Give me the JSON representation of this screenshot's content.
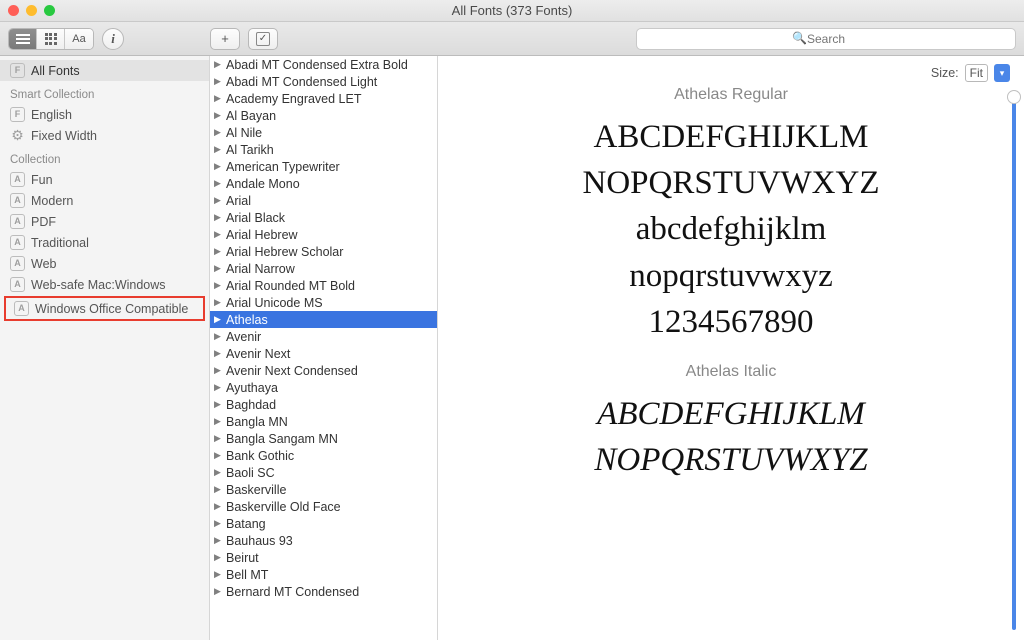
{
  "window": {
    "title": "All Fonts (373 Fonts)"
  },
  "toolbar": {
    "aa_label": "Aa",
    "info_label": "i",
    "add_label": "+",
    "check_label": "✓",
    "search_placeholder": "Search"
  },
  "sidebar": {
    "all_fonts": "All Fonts",
    "smart_header": "Smart Collection",
    "english": "English",
    "fixed_width": "Fixed Width",
    "collection_header": "Collection",
    "collections": [
      "Fun",
      "Modern",
      "PDF",
      "Traditional",
      "Web",
      "Web-safe Mac:Windows",
      "Windows Office Compatible"
    ]
  },
  "fonts": [
    "Abadi MT Condensed Extra Bold",
    "Abadi MT Condensed Light",
    "Academy Engraved LET",
    "Al Bayan",
    "Al Nile",
    "Al Tarikh",
    "American Typewriter",
    "Andale Mono",
    "Arial",
    "Arial Black",
    "Arial Hebrew",
    "Arial Hebrew Scholar",
    "Arial Narrow",
    "Arial Rounded MT Bold",
    "Arial Unicode MS",
    "Athelas",
    "Avenir",
    "Avenir Next",
    "Avenir Next Condensed",
    "Ayuthaya",
    "Baghdad",
    "Bangla MN",
    "Bangla Sangam MN",
    "Bank Gothic",
    "Baoli SC",
    "Baskerville",
    "Baskerville Old Face",
    "Batang",
    "Bauhaus 93",
    "Beirut",
    "Bell MT",
    "Bernard MT Condensed"
  ],
  "preview": {
    "size_label": "Size:",
    "size_value": "Fit",
    "style1_title": "Athelas Regular",
    "style2_title": "Athelas Italic",
    "upper": "ABCDEFGHIJKLM",
    "upper2": "NOPQRSTUVWXYZ",
    "lower": "abcdefghijklm",
    "lower2": "nopqrstuvwxyz",
    "digits": "1234567890"
  }
}
